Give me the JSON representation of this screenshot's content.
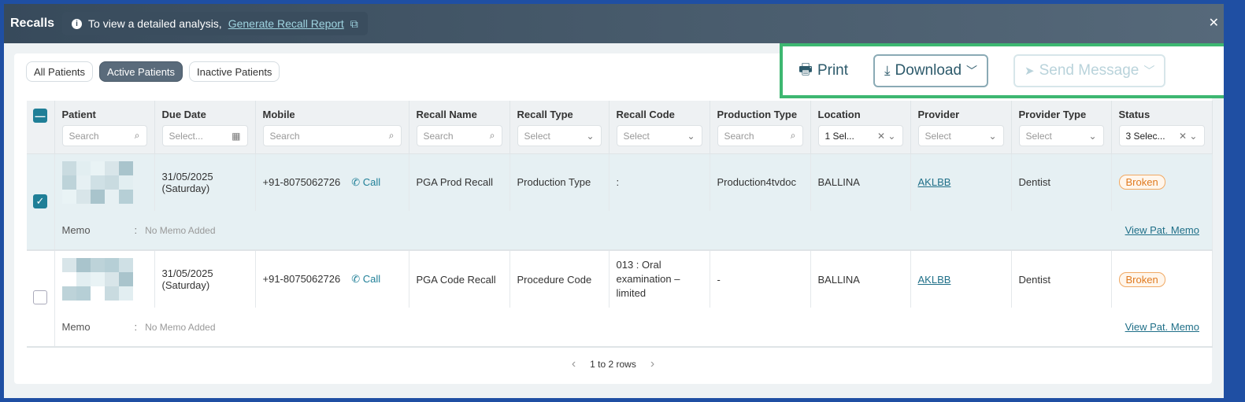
{
  "window": {
    "title": "Recalls",
    "info_text": "To view a detailed analysis,",
    "info_link": "Generate Recall Report",
    "close": "✕"
  },
  "tabs": [
    {
      "label": "All Patients"
    },
    {
      "label": "Active Patients"
    },
    {
      "label": "Inactive Patients"
    }
  ],
  "active_tab": "Active Patients",
  "actions": {
    "print": "Print",
    "download": "Download",
    "send_message": "Send Message"
  },
  "columns": [
    {
      "label": "Patient",
      "filter": "Search",
      "filter_type": "search"
    },
    {
      "label": "Due Date",
      "filter": "Select...",
      "filter_type": "date"
    },
    {
      "label": "Mobile",
      "filter": "Search",
      "filter_type": "search"
    },
    {
      "label": "Recall Name",
      "filter": "Search",
      "filter_type": "search"
    },
    {
      "label": "Recall Type",
      "filter": "Select",
      "filter_type": "select"
    },
    {
      "label": "Recall Code",
      "filter": "Select",
      "filter_type": "select"
    },
    {
      "label": "Production Type",
      "filter": "Search",
      "filter_type": "search"
    },
    {
      "label": "Location",
      "filter": "1 Sel...",
      "filter_type": "multiselect"
    },
    {
      "label": "Provider",
      "filter": "Select",
      "filter_type": "select"
    },
    {
      "label": "Provider Type",
      "filter": "Select",
      "filter_type": "select"
    },
    {
      "label": "Status",
      "filter": "3 Selec...",
      "filter_type": "multiselect"
    }
  ],
  "rows": [
    {
      "checked": true,
      "due_date": "31/05/2025",
      "due_day": "(Saturday)",
      "mobile": "+91-8075062726",
      "call": "Call",
      "recall_name": "PGA Prod Recall",
      "recall_type": "Production Type",
      "recall_code": ":",
      "production_type": "Production4tvdoc",
      "location": "BALLINA",
      "provider": "AKLBB",
      "provider_type": "Dentist",
      "status": "Broken",
      "memo_label": "Memo",
      "memo_sep": ":",
      "memo": "No Memo Added",
      "memo_link": "View Pat. Memo"
    },
    {
      "checked": false,
      "due_date": "31/05/2025",
      "due_day": "(Saturday)",
      "mobile": "+91-8075062726",
      "call": "Call",
      "recall_name": "PGA Code Recall",
      "recall_type": "Procedure Code",
      "recall_code": "013 : Oral examination – limited",
      "production_type": "-",
      "location": "BALLINA",
      "provider": "AKLBB",
      "provider_type": "Dentist",
      "status": "Broken",
      "memo_label": "Memo",
      "memo_sep": ":",
      "memo": "No Memo Added",
      "memo_link": "View Pat. Memo"
    }
  ],
  "pagination": {
    "text": "1 to 2 rows"
  },
  "colors": {
    "accent": "#1f7f97",
    "highlight_border": "#3db771",
    "status_broken": "#e07a1f"
  }
}
